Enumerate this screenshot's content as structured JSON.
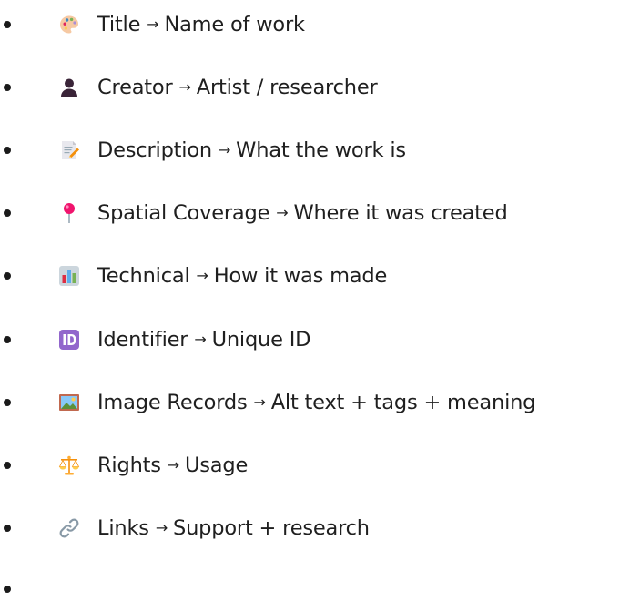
{
  "items": [
    {
      "icon": "palette-icon",
      "label": "Title",
      "arrow": "→",
      "desc": "Name of work"
    },
    {
      "icon": "person-silhouette-icon",
      "label": "Creator",
      "arrow": "→",
      "desc": "Artist / researcher"
    },
    {
      "icon": "memo-pencil-icon",
      "label": "Description",
      "arrow": "→",
      "desc": "What the work is"
    },
    {
      "icon": "round-pushpin-icon",
      "label": "Spatial Coverage",
      "arrow": "→",
      "desc": "Where it was created"
    },
    {
      "icon": "bar-chart-icon",
      "label": "Technical",
      "arrow": "→",
      "desc": "How it was made"
    },
    {
      "icon": "id-button-icon",
      "label": "Identifier",
      "arrow": "→",
      "desc": "Unique ID"
    },
    {
      "icon": "framed-picture-icon",
      "label": "Image Records",
      "arrow": "→",
      "desc": "Alt text + tags + meaning"
    },
    {
      "icon": "balance-scale-icon",
      "label": "Rights",
      "arrow": "→",
      "desc": "Usage"
    },
    {
      "icon": "link-icon",
      "label": "Links",
      "arrow": "→",
      "desc": "Support + research"
    },
    {
      "icon": "",
      "label": "",
      "arrow": "",
      "desc": ""
    }
  ]
}
